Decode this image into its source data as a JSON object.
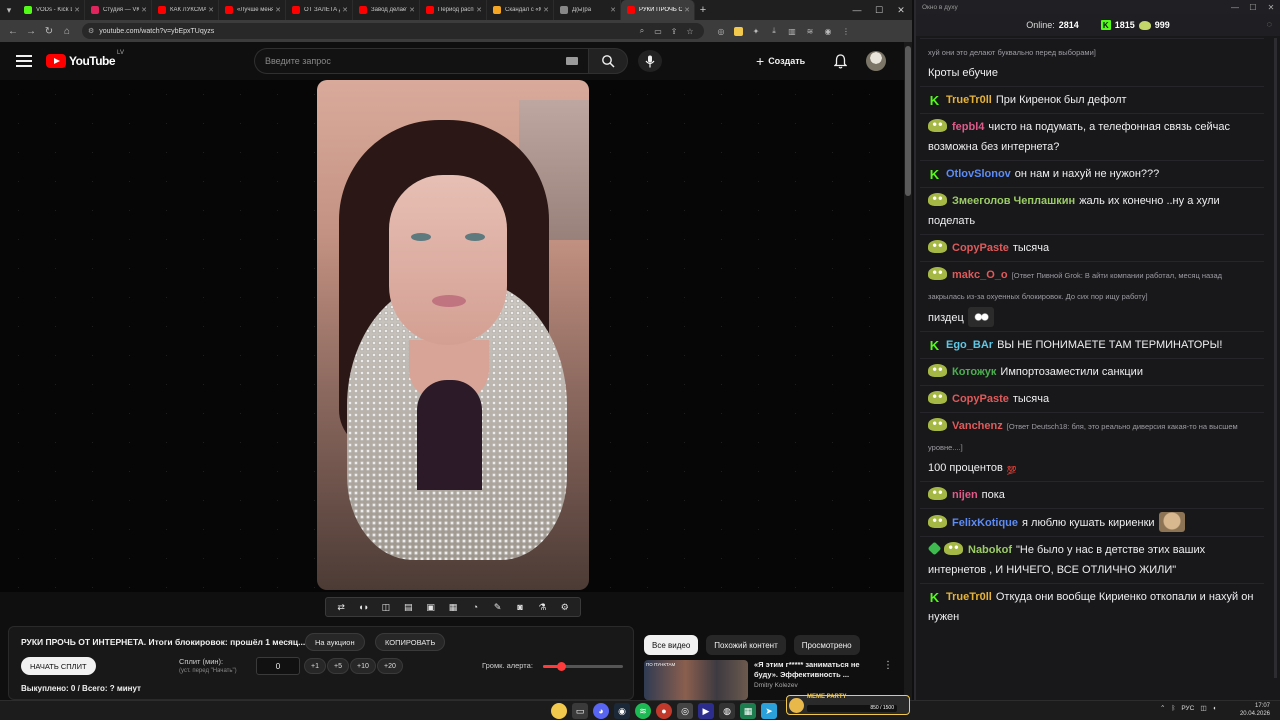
{
  "browser": {
    "tabs": [
      {
        "title": "VODs - Kick Du",
        "color": "#53fc18"
      },
      {
        "title": "Студия — VK В",
        "color": "#e0245e"
      },
      {
        "title": "КАК ЛУКСМАКС",
        "color": "#ff0000"
      },
      {
        "title": "«Лучше меня у",
        "color": "#ff0000"
      },
      {
        "title": "ОТ ЗАЛЕТА ДО",
        "color": "#ff0000"
      },
      {
        "title": "Завод делает б",
        "color": "#ff0000"
      },
      {
        "title": "Период распис",
        "color": "#ff0000"
      },
      {
        "title": "Скандал с «Ма",
        "color": "#f5a623"
      },
      {
        "title": "Д(ы)ра",
        "color": "#888888"
      },
      {
        "title": "РУКИ ПРОЧЬ О",
        "color": "#ff0000",
        "active": true
      }
    ],
    "url": "youtube.com/watch?v=ybEpxTUqyzs"
  },
  "youtube": {
    "logo": "YouTube",
    "country": "LV",
    "search_placeholder": "Введите запрос",
    "create_label": "Создать"
  },
  "panel": {
    "video_title": "РУКИ ПРОЧЬ ОТ ИНТЕРНЕТА. Итоги блокировок: прошёл 1 месяц...",
    "auction_button": "На аукцион",
    "copy_button": "КОПИРОВАТЬ",
    "start_split_button": "НАЧАТЬ СПЛИТ",
    "split_label": "Сплит (мин):",
    "split_sub": "(уст. перед \"Начать\")",
    "split_value": "0",
    "plus1": "+1",
    "plus5": "+5",
    "plus10": "+10",
    "plus20": "+20",
    "volume_label": "Громк. алерта:",
    "volume_level": 0.22,
    "bought": "Выкуплено: 0 / Всего: ? минут"
  },
  "recs": {
    "chips": [
      "Все видео",
      "Похожий контент",
      "Просмотрено"
    ],
    "first": {
      "title": "«Я этим г***** заниматься не буду». Эффективность ...",
      "channel": "Dmitry Kolezev",
      "thumb_tag": "ПО ПУНКТАМ"
    }
  },
  "chat": {
    "window_title": "Окно в духу",
    "online_label": "Online:",
    "online_value": "2814",
    "kick_count": "1815",
    "other_count": "999",
    "messages": [
      {
        "badge": "",
        "user": "",
        "color": "#efeff1",
        "reply": "хуй они это делают буквально перед выборами]",
        "text": "Кроты ебучие",
        "emote": ""
      },
      {
        "badge": "kick",
        "user": "TrueTr0ll",
        "color": "#e6b33a",
        "reply": "",
        "text": "При Киренок был дефолт",
        "emote": ""
      },
      {
        "badge": "pepe",
        "user": "fepbl4",
        "color": "#e05a8a",
        "reply": "",
        "text": "чисто на подумать, а телефонная связь сейчас возможна без интернета?",
        "emote": ""
      },
      {
        "badge": "kick",
        "user": "OtlovSlonov",
        "color": "#5d8cf5",
        "reply": "",
        "text": "он нам и нахуй не нужон???",
        "emote": ""
      },
      {
        "badge": "pepe",
        "user": "Змееголов Чеплашкин",
        "color": "#9ccc65",
        "reply": "",
        "text": "жаль их конечно ..ну а хули поделать",
        "emote": ""
      },
      {
        "badge": "pepe",
        "user": "CopyPaste",
        "color": "#e05a5a",
        "reply": "",
        "text": "тысяча",
        "emote": ""
      },
      {
        "badge": "pepe",
        "user": "makc_O_o",
        "color": "#e05a5a",
        "reply": "[Ответ Пивной Grok: В айти компании работал, месяц назад закрылась из-за охуенных блокировок. До сих пор ищу работу]",
        "text": "пиздец",
        "emote": "cat"
      },
      {
        "badge": "kick",
        "user": "Ego_BAr",
        "color": "#5ec8e5",
        "reply": "",
        "text": "ВЫ НЕ ПОНИМАЕТЕ ТАМ ТЕРМИНАТОРЫ!",
        "emote": ""
      },
      {
        "badge": "pepe",
        "user": "Котожук",
        "color": "#4caf50",
        "reply": "",
        "text": "Импортозаместили санкции",
        "emote": ""
      },
      {
        "badge": "pepe",
        "user": "CopyPaste",
        "color": "#e05a5a",
        "reply": "",
        "text": "тысяча",
        "emote": ""
      },
      {
        "badge": "pepe",
        "user": "Vanchenz",
        "color": "#e05a5a",
        "reply": "[Ответ Deutsch18: бля, это реально диверсия какая-то на высшем уровне....]",
        "text": "100 процентов",
        "emote": "hundred"
      },
      {
        "badge": "pepe",
        "user": "nijen",
        "color": "#e05a8a",
        "reply": "",
        "text": "пока",
        "emote": ""
      },
      {
        "badge": "pepe",
        "user": "FelixKotique",
        "color": "#5d8cf5",
        "reply": "",
        "text": "я люблю кушать кириенки",
        "emote": "dog"
      },
      {
        "badge": "gempepe",
        "user": "Nabokof",
        "color": "#9ccc65",
        "reply": "",
        "text": "\"Не было у нас в детстве этих ваших интернетов , И НИЧЕГО, ВСЕ ОТЛИЧНО ЖИЛИ\"",
        "emote": ""
      },
      {
        "badge": "kick",
        "user": "TrueTr0ll",
        "color": "#e6b33a",
        "reply": "",
        "text": "Откуда они вообще Кириенко откопали и нахуй он нужен",
        "emote": ""
      }
    ]
  },
  "taskbar": {
    "meme_title": "MEME PARTY",
    "meme_progress": "850 / 1500",
    "lang": "РУС",
    "time": "17:07",
    "date": "20.04.2026"
  }
}
